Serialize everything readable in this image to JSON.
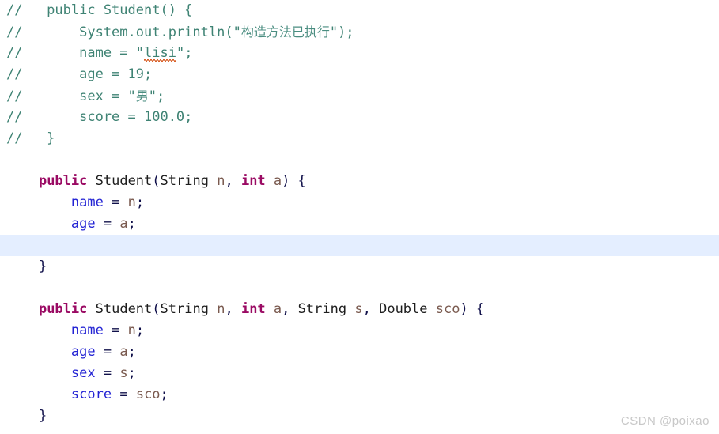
{
  "editor": {
    "language": "java",
    "background": "#ffffff",
    "highlight_color": "#e4eeff",
    "colors": {
      "comment": "#3f8374",
      "keyword": "#9a0a63",
      "field": "#2323d4",
      "parameter": "#7a5a4f",
      "type": "#1d1d1d",
      "punctuation": "#10104a",
      "typo_underline": "#d9622b",
      "watermark": "#c8c8c8"
    }
  },
  "lines": [
    {
      "index": 0,
      "highlighted": false,
      "text": "//   public Student() {",
      "tokens": [
        {
          "kind": "comment",
          "text": "//   public Student() {"
        }
      ]
    },
    {
      "index": 1,
      "highlighted": false,
      "text": "//       System.out.println(\"构造方法已执行\");",
      "tokens": [
        {
          "kind": "comment",
          "text": "//       System.out.println(\""
        },
        {
          "kind": "cjk",
          "text": "构造方法已执行"
        },
        {
          "kind": "comment",
          "text": "\");"
        }
      ]
    },
    {
      "index": 2,
      "highlighted": false,
      "text": "//       name = \"lisi\";",
      "tokens": [
        {
          "kind": "comment",
          "text": "//       name = \""
        },
        {
          "kind": "comment-typo",
          "text": "lisi"
        },
        {
          "kind": "comment",
          "text": "\";"
        }
      ]
    },
    {
      "index": 3,
      "highlighted": false,
      "text": "//       age = 19;",
      "tokens": [
        {
          "kind": "comment",
          "text": "//       age = 19;"
        }
      ]
    },
    {
      "index": 4,
      "highlighted": false,
      "text": "//       sex = \"男\";",
      "tokens": [
        {
          "kind": "comment",
          "text": "//       sex = \""
        },
        {
          "kind": "cjk",
          "text": "男"
        },
        {
          "kind": "comment",
          "text": "\";"
        }
      ]
    },
    {
      "index": 5,
      "highlighted": false,
      "text": "//       score = 100.0;",
      "tokens": [
        {
          "kind": "comment",
          "text": "//       score = 100.0;"
        }
      ]
    },
    {
      "index": 6,
      "highlighted": false,
      "text": "//   }",
      "tokens": [
        {
          "kind": "comment",
          "text": "//   }"
        }
      ]
    },
    {
      "index": 7,
      "highlighted": false,
      "text": "",
      "tokens": []
    },
    {
      "index": 8,
      "highlighted": false,
      "text": "    public Student(String n, int a) {",
      "tokens": [
        {
          "kind": "plain",
          "text": "    "
        },
        {
          "kind": "keyword",
          "text": "public"
        },
        {
          "kind": "plain",
          "text": " "
        },
        {
          "kind": "type",
          "text": "Student"
        },
        {
          "kind": "punct",
          "text": "("
        },
        {
          "kind": "type",
          "text": "String"
        },
        {
          "kind": "plain",
          "text": " "
        },
        {
          "kind": "param",
          "text": "n"
        },
        {
          "kind": "punct",
          "text": ","
        },
        {
          "kind": "plain",
          "text": " "
        },
        {
          "kind": "keyword",
          "text": "int"
        },
        {
          "kind": "plain",
          "text": " "
        },
        {
          "kind": "param",
          "text": "a"
        },
        {
          "kind": "punct",
          "text": ")"
        },
        {
          "kind": "plain",
          "text": " "
        },
        {
          "kind": "punct",
          "text": "{"
        }
      ]
    },
    {
      "index": 9,
      "highlighted": false,
      "text": "        name = n;",
      "tokens": [
        {
          "kind": "plain",
          "text": "        "
        },
        {
          "kind": "field",
          "text": "name"
        },
        {
          "kind": "plain",
          "text": " "
        },
        {
          "kind": "punct",
          "text": "="
        },
        {
          "kind": "plain",
          "text": " "
        },
        {
          "kind": "param",
          "text": "n"
        },
        {
          "kind": "punct",
          "text": ";"
        }
      ]
    },
    {
      "index": 10,
      "highlighted": false,
      "text": "        age = a;",
      "tokens": [
        {
          "kind": "plain",
          "text": "        "
        },
        {
          "kind": "field",
          "text": "age"
        },
        {
          "kind": "plain",
          "text": " "
        },
        {
          "kind": "punct",
          "text": "="
        },
        {
          "kind": "plain",
          "text": " "
        },
        {
          "kind": "param",
          "text": "a"
        },
        {
          "kind": "punct",
          "text": ";"
        }
      ]
    },
    {
      "index": 11,
      "highlighted": true,
      "text": "",
      "tokens": []
    },
    {
      "index": 12,
      "highlighted": false,
      "text": "    }",
      "tokens": [
        {
          "kind": "plain",
          "text": "    "
        },
        {
          "kind": "punct",
          "text": "}"
        }
      ]
    },
    {
      "index": 13,
      "highlighted": false,
      "text": "",
      "tokens": []
    },
    {
      "index": 14,
      "highlighted": false,
      "text": "    public Student(String n, int a, String s, Double sco) {",
      "tokens": [
        {
          "kind": "plain",
          "text": "    "
        },
        {
          "kind": "keyword",
          "text": "public"
        },
        {
          "kind": "plain",
          "text": " "
        },
        {
          "kind": "type",
          "text": "Student"
        },
        {
          "kind": "punct",
          "text": "("
        },
        {
          "kind": "type",
          "text": "String"
        },
        {
          "kind": "plain",
          "text": " "
        },
        {
          "kind": "param",
          "text": "n"
        },
        {
          "kind": "punct",
          "text": ","
        },
        {
          "kind": "plain",
          "text": " "
        },
        {
          "kind": "keyword",
          "text": "int"
        },
        {
          "kind": "plain",
          "text": " "
        },
        {
          "kind": "param",
          "text": "a"
        },
        {
          "kind": "punct",
          "text": ","
        },
        {
          "kind": "plain",
          "text": " "
        },
        {
          "kind": "type",
          "text": "String"
        },
        {
          "kind": "plain",
          "text": " "
        },
        {
          "kind": "param",
          "text": "s"
        },
        {
          "kind": "punct",
          "text": ","
        },
        {
          "kind": "plain",
          "text": " "
        },
        {
          "kind": "type",
          "text": "Double"
        },
        {
          "kind": "plain",
          "text": " "
        },
        {
          "kind": "param",
          "text": "sco"
        },
        {
          "kind": "punct",
          "text": ")"
        },
        {
          "kind": "plain",
          "text": " "
        },
        {
          "kind": "punct",
          "text": "{"
        }
      ]
    },
    {
      "index": 15,
      "highlighted": false,
      "text": "        name = n;",
      "tokens": [
        {
          "kind": "plain",
          "text": "        "
        },
        {
          "kind": "field",
          "text": "name"
        },
        {
          "kind": "plain",
          "text": " "
        },
        {
          "kind": "punct",
          "text": "="
        },
        {
          "kind": "plain",
          "text": " "
        },
        {
          "kind": "param",
          "text": "n"
        },
        {
          "kind": "punct",
          "text": ";"
        }
      ]
    },
    {
      "index": 16,
      "highlighted": false,
      "text": "        age = a;",
      "tokens": [
        {
          "kind": "plain",
          "text": "        "
        },
        {
          "kind": "field",
          "text": "age"
        },
        {
          "kind": "plain",
          "text": " "
        },
        {
          "kind": "punct",
          "text": "="
        },
        {
          "kind": "plain",
          "text": " "
        },
        {
          "kind": "param",
          "text": "a"
        },
        {
          "kind": "punct",
          "text": ";"
        }
      ]
    },
    {
      "index": 17,
      "highlighted": false,
      "text": "        sex = s;",
      "tokens": [
        {
          "kind": "plain",
          "text": "        "
        },
        {
          "kind": "field",
          "text": "sex"
        },
        {
          "kind": "plain",
          "text": " "
        },
        {
          "kind": "punct",
          "text": "="
        },
        {
          "kind": "plain",
          "text": " "
        },
        {
          "kind": "param",
          "text": "s"
        },
        {
          "kind": "punct",
          "text": ";"
        }
      ]
    },
    {
      "index": 18,
      "highlighted": false,
      "text": "        score = sco;",
      "tokens": [
        {
          "kind": "plain",
          "text": "        "
        },
        {
          "kind": "field",
          "text": "score"
        },
        {
          "kind": "plain",
          "text": " "
        },
        {
          "kind": "punct",
          "text": "="
        },
        {
          "kind": "plain",
          "text": " "
        },
        {
          "kind": "param",
          "text": "sco"
        },
        {
          "kind": "punct",
          "text": ";"
        }
      ]
    },
    {
      "index": 19,
      "highlighted": false,
      "text": "    }",
      "tokens": [
        {
          "kind": "plain",
          "text": "    "
        },
        {
          "kind": "punct",
          "text": "}"
        }
      ]
    }
  ],
  "watermark": {
    "text": "CSDN @poixao"
  }
}
